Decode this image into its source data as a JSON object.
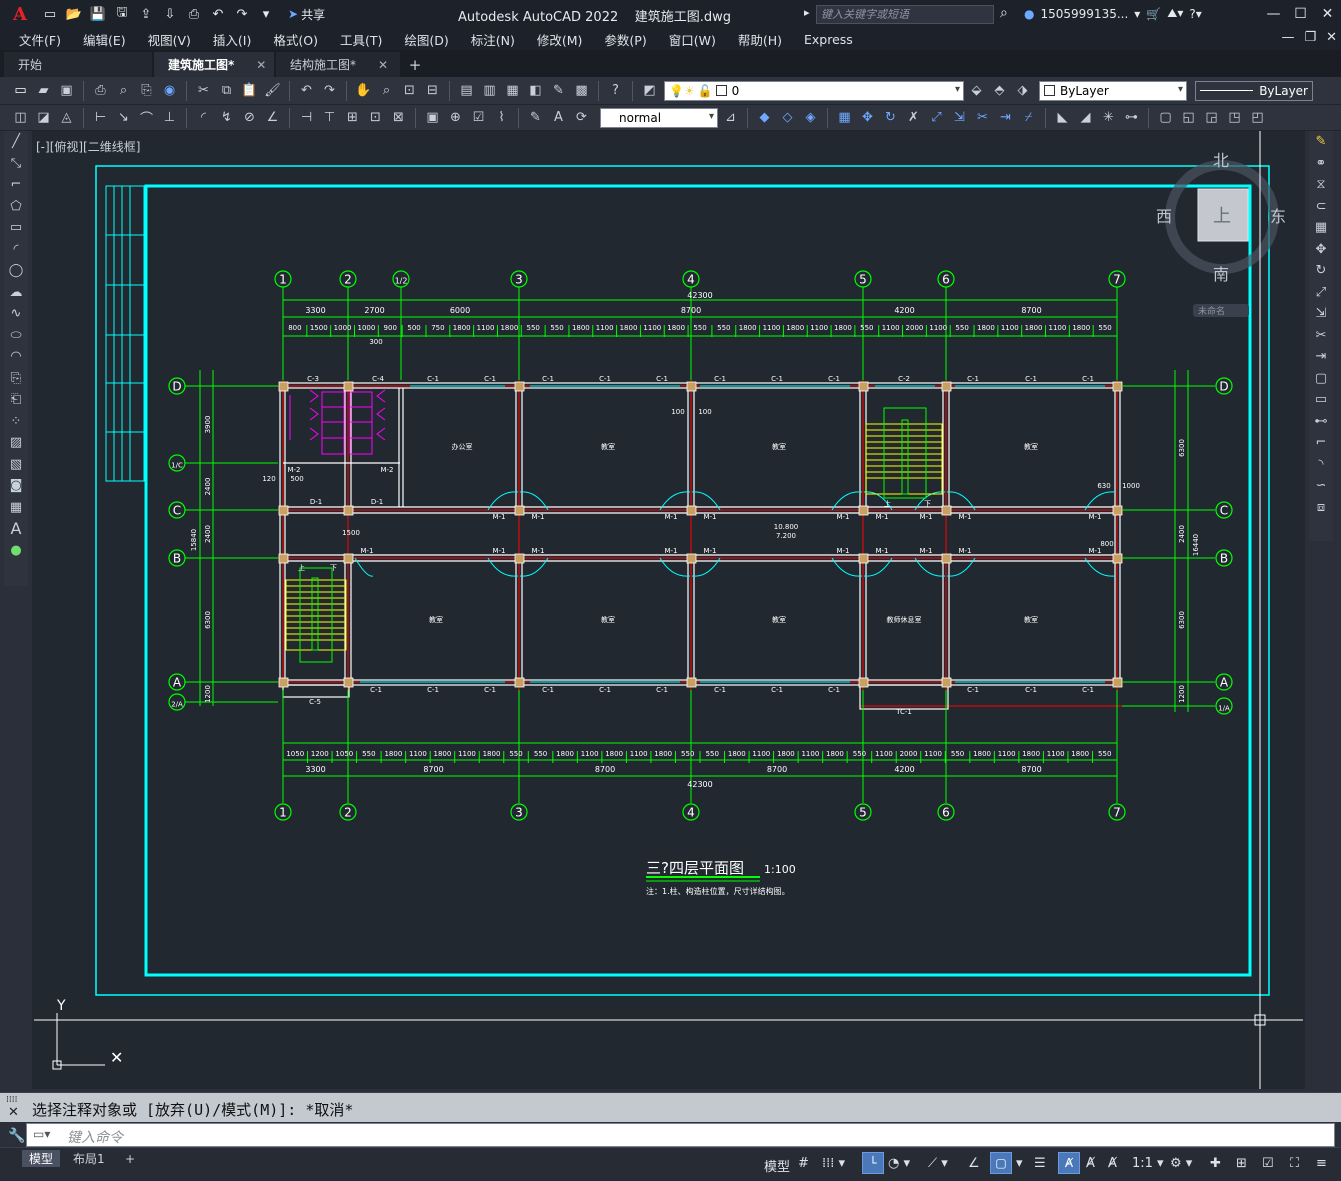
{
  "app": {
    "title": "Autodesk AutoCAD 2022",
    "file": "建筑施工图.dwg",
    "logo": "A",
    "share": "共享",
    "search_placeholder": "键入关键字或短语",
    "user": "1505999135..."
  },
  "menu": [
    "文件(F)",
    "编辑(E)",
    "视图(V)",
    "插入(I)",
    "格式(O)",
    "工具(T)",
    "绘图(D)",
    "标注(N)",
    "修改(M)",
    "参数(P)",
    "窗口(W)",
    "帮助(H)",
    "Express"
  ],
  "tabs": [
    {
      "label": "开始"
    },
    {
      "label": "建筑施工图*"
    },
    {
      "label": "结构施工图*"
    }
  ],
  "toolbar": {
    "layer": "0",
    "color": "ByLayer",
    "linetype": "ByLayer",
    "style": "normal"
  },
  "viewport": {
    "label": "[-][俯视][二维线框]",
    "viewcube": {
      "top": "上",
      "north": "北",
      "south": "南",
      "east": "东",
      "west": "西",
      "wcs": "未命名"
    }
  },
  "drawing": {
    "axes_top": [
      "1",
      "2",
      "1/2",
      "3",
      "4",
      "5",
      "6",
      "7"
    ],
    "axes_bottom": [
      "1",
      "2",
      "3",
      "4",
      "5",
      "6",
      "7"
    ],
    "rows_left": [
      "D",
      "1/C",
      "C",
      "B",
      "A",
      "2/A"
    ],
    "rows_right": [
      "D",
      "C",
      "B",
      "A",
      "1/A"
    ],
    "dim_total": "42300",
    "dims_top_l1": [
      "3300",
      "2700",
      "6000",
      "8700",
      "4200",
      "8700"
    ],
    "dims_top_l2": [
      "800",
      "1500",
      "1000",
      "1000",
      "900",
      "500",
      "750",
      "1800",
      "1100",
      "1800",
      "550",
      "550",
      "1800",
      "1100",
      "1800",
      "1100",
      "1800",
      "550",
      "550",
      "1800",
      "1100",
      "1800",
      "1100",
      "1800",
      "550",
      "1100",
      "2000",
      "1100",
      "550",
      "1800",
      "1100",
      "1800",
      "1100",
      "1800",
      "550"
    ],
    "dims_bottom_l1": [
      "3300",
      "8700",
      "8700",
      "8700",
      "4200",
      "8700"
    ],
    "dims_bottom_l2": [
      "1050",
      "1200",
      "1050",
      "550",
      "1800",
      "1100",
      "1800",
      "1100",
      "1800",
      "550",
      "550",
      "1800",
      "1100",
      "1800",
      "1100",
      "1800",
      "550",
      "550",
      "1800",
      "1100",
      "1800",
      "1100",
      "1800",
      "550",
      "1100",
      "2000",
      "1100",
      "550",
      "1800",
      "1100",
      "1800",
      "1100",
      "1800",
      "550"
    ],
    "dims_left": [
      "3900",
      "2400",
      "2400",
      "6300",
      "1200"
    ],
    "dims_left_total": "15840",
    "dims_right": [
      "6300",
      "2400",
      "6300",
      "1200"
    ],
    "dims_right_total": "16440",
    "rooms": {
      "office": "办公室",
      "classroom": "教室",
      "teacher": "教师休息室"
    },
    "windows": [
      "C-3",
      "C-4",
      "C-1",
      "C-2",
      "C-5",
      "TC-1"
    ],
    "doors": [
      "M-1",
      "M-2",
      "D-1"
    ],
    "elevations": [
      "10.800",
      "7.200"
    ],
    "small_dims": [
      "100",
      "100",
      "300",
      "120",
      "500",
      "630",
      "1000",
      "1500",
      "800"
    ],
    "stair_up": "上",
    "stair_down": "下",
    "title": "三?四层平面图",
    "scale": "1:100",
    "note": "注：1.柱、构造柱位置，尺寸详结构图。"
  },
  "command": {
    "history": "选择注释对象或 [放弃(U)/模式(M)]: *取消*",
    "placeholder": "键入命令"
  },
  "layouts": [
    {
      "label": "模型"
    },
    {
      "label": "布局1"
    }
  ],
  "status": {
    "model": "模型",
    "scale": "1:1"
  },
  "colors": {
    "bg": "#212830",
    "green": "#00ff00",
    "cyan": "#00ffff",
    "red": "#ff0000",
    "yellow": "#ffff00",
    "magenta": "#ff00ff"
  }
}
